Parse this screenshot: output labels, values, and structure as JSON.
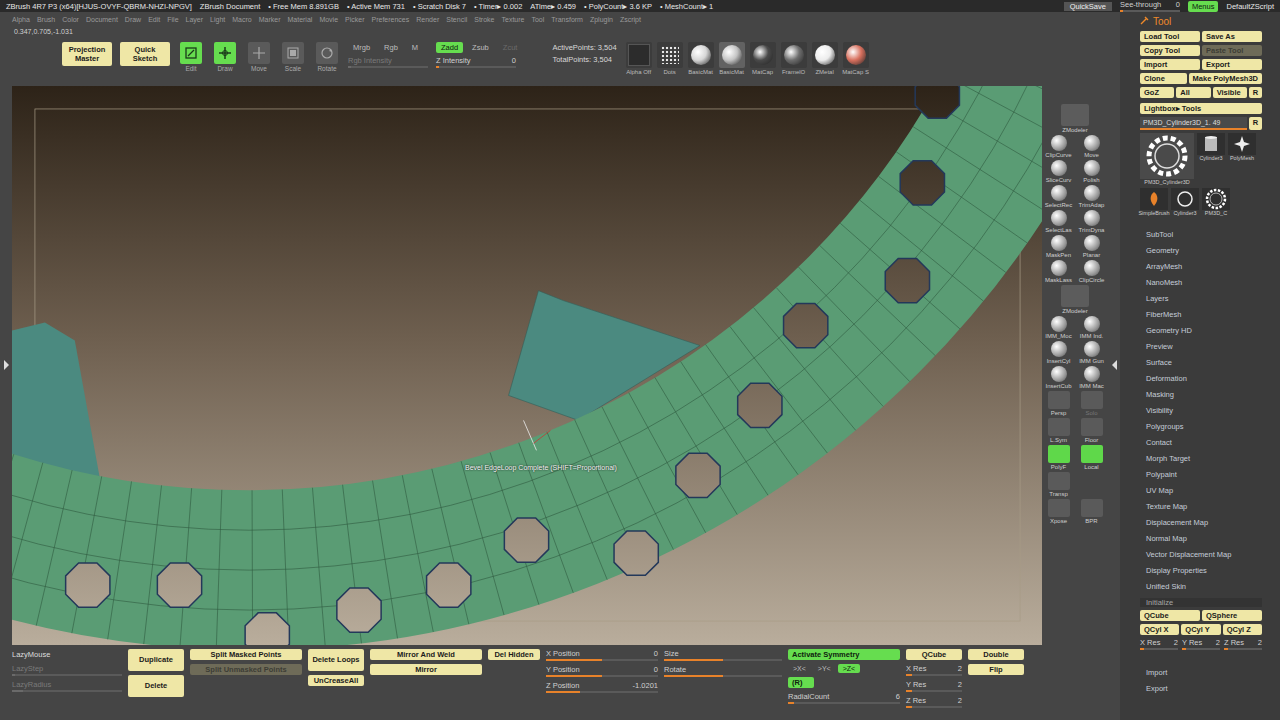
{
  "title_bar": {
    "app": "ZBrush 4R7 P3 (x64)[HJUS-OVYF-QBRM-NHZI-NPGV]",
    "document": "ZBrush Document",
    "stats": [
      "• Free Mem 8.891GB",
      "• Active Mem 731",
      "• Scratch Disk 7",
      "• Timer▸ 0.002",
      "ATime▸ 0.459",
      "• PolyCount▸ 3.6 KP",
      "• MeshCount▸ 1"
    ],
    "quicksave": "QuickSave",
    "see_through": {
      "label": "See-through",
      "reading": "0",
      "level": 0
    },
    "menus": {
      "label": "Menus",
      "selected": true
    },
    "script": "DefaultZScript"
  },
  "menu": [
    "Alpha",
    "Brush",
    "Color",
    "Document",
    "Draw",
    "Edit",
    "File",
    "Layer",
    "Light",
    "Macro",
    "Marker",
    "Material",
    "Movie",
    "Picker",
    "Preferences",
    "Render",
    "Stencil",
    "Stroke",
    "Texture",
    "Tool",
    "Transform",
    "Zplugin",
    "Zscript"
  ],
  "coords": "0.347,0.705,-1.031",
  "toolbar": {
    "big_buttons": [
      "Projection Master",
      "Quick Sketch"
    ],
    "modes": [
      {
        "label": "Edit",
        "selected": true
      },
      {
        "label": "Draw",
        "selected": true
      },
      {
        "label": "Move",
        "selected": false
      },
      {
        "label": "Scale",
        "selected": false
      },
      {
        "label": "Rotate",
        "selected": false
      }
    ],
    "channels": [
      {
        "label": "Mrgb",
        "selected": false
      },
      {
        "label": "Rgb",
        "selected": false
      },
      {
        "label": "M",
        "selected": false
      }
    ],
    "rgb_intensity": {
      "label": "Rgb Intensity",
      "level": 0,
      "disabled": true
    },
    "z_modes": [
      {
        "label": "Zadd",
        "selected": true,
        "disabled": false
      },
      {
        "label": "Zsub",
        "selected": false,
        "disabled": false
      },
      {
        "label": "Zcut",
        "selected": false,
        "disabled": true
      }
    ],
    "z_intensity": {
      "label": "Z Intensity",
      "reading": "0",
      "level": 0
    },
    "points": [
      "ActivePoints: 3,504",
      "TotalPoints: 3,504"
    ],
    "materials": [
      {
        "label": "Alpha Off",
        "kind": "alpha",
        "color": "#2c2c2c",
        "selected": false
      },
      {
        "label": "Dots",
        "kind": "stroke",
        "color": "#e8e8e8",
        "selected": false
      },
      {
        "label": "BasicMat",
        "kind": "sphere",
        "color": "#d6d6d6",
        "selected": false
      },
      {
        "label": "BasicMat",
        "kind": "sphere",
        "color": "#c4c4c4",
        "selected": true
      },
      {
        "label": "MatCap",
        "kind": "sphere",
        "color": "#4a4a4a",
        "selected": false
      },
      {
        "label": "FramelO",
        "kind": "sphere",
        "color": "#6e6e6e",
        "selected": false
      },
      {
        "label": "ZMetal",
        "kind": "sphere",
        "color": "#ececec",
        "selected": false
      },
      {
        "label": "MatCap S",
        "kind": "sphere",
        "color": "#d8705e",
        "selected": false
      }
    ]
  },
  "viewport": {
    "tooltip": "Bevel EdgeLoop Complete (SHIFT=Proportional)"
  },
  "shelf": [
    {
      "label": "ZModeler",
      "kind": "wide",
      "selected": false,
      "disabled": false
    },
    {
      "label": "ClipCurve",
      "kind": "brush",
      "selected": false,
      "disabled": false
    },
    {
      "label": "Move",
      "kind": "brush",
      "selected": false,
      "disabled": false
    },
    {
      "label": "SliceCurv",
      "kind": "brush",
      "selected": false,
      "disabled": false
    },
    {
      "label": "Polish",
      "kind": "brush",
      "selected": false,
      "disabled": false
    },
    {
      "label": "SelectRec",
      "kind": "brush",
      "selected": false,
      "disabled": false
    },
    {
      "label": "TrimAdap",
      "kind": "brush",
      "selected": false,
      "disabled": false
    },
    {
      "label": "SelectLas",
      "kind": "brush",
      "selected": false,
      "disabled": false
    },
    {
      "label": "TrimDyna",
      "kind": "brush",
      "selected": false,
      "disabled": false
    },
    {
      "label": "MaskPen",
      "kind": "brush",
      "selected": false,
      "disabled": false
    },
    {
      "label": "Planar",
      "kind": "brush",
      "selected": false,
      "disabled": false
    },
    {
      "label": "MaskLass",
      "kind": "brush",
      "selected": false,
      "disabled": false
    },
    {
      "label": "ClipCircle",
      "kind": "brush",
      "selected": false,
      "disabled": false
    },
    {
      "label": "ZModeler",
      "kind": "wide",
      "selected": false,
      "disabled": false
    },
    {
      "label": "IMM_Moc",
      "kind": "brush",
      "selected": false,
      "disabled": false
    },
    {
      "label": "IMM Ind.",
      "kind": "brush",
      "selected": false,
      "disabled": false
    },
    {
      "label": "InsertCyl",
      "kind": "brush",
      "selected": false,
      "disabled": false
    },
    {
      "label": "IMM Gun",
      "kind": "brush",
      "selected": false,
      "disabled": false
    },
    {
      "label": "InsertCub",
      "kind": "brush",
      "selected": false,
      "disabled": false
    },
    {
      "label": "IMM Mac",
      "kind": "brush",
      "selected": false,
      "disabled": false
    },
    {
      "label": "Persp",
      "kind": "toggle",
      "selected": false,
      "disabled": false
    },
    {
      "label": "Solo",
      "kind": "toggle",
      "selected": false,
      "disabled": true
    },
    {
      "label": "L.Sym",
      "kind": "toggle",
      "selected": false,
      "disabled": false
    },
    {
      "label": "Floor",
      "kind": "toggle",
      "selected": false,
      "disabled": false
    },
    {
      "label": "PolyF",
      "kind": "toggle",
      "selected": true,
      "disabled": false
    },
    {
      "label": "Local",
      "kind": "toggle",
      "selected": true,
      "disabled": false
    },
    {
      "label": "Transp",
      "kind": "toggle",
      "selected": false,
      "disabled": false
    },
    {
      "label": "",
      "kind": "spacer",
      "selected": false,
      "disabled": false
    },
    {
      "label": "Xpose",
      "kind": "toggle",
      "selected": false,
      "disabled": false
    },
    {
      "label": "BPR",
      "kind": "toggle",
      "selected": false,
      "disabled": false
    }
  ],
  "tool_panel": {
    "title": "Tool",
    "buttons": [
      [
        {
          "label": "Load Tool",
          "disabled": false
        },
        {
          "label": "Save As",
          "disabled": false
        }
      ],
      [
        {
          "label": "Copy Tool",
          "disabled": false
        },
        {
          "label": "Paste Tool",
          "disabled": true
        }
      ],
      [
        {
          "label": "Import",
          "disabled": false
        },
        {
          "label": "Export",
          "disabled": false
        }
      ],
      [
        {
          "label": "Clone",
          "disabled": false
        },
        {
          "label": "Make PolyMesh3D",
          "disabled": false
        }
      ],
      [
        {
          "label": "GoZ",
          "disabled": false
        },
        {
          "label": "All",
          "disabled": false
        },
        {
          "label": "Visible",
          "disabled": false
        },
        {
          "label": "R",
          "disabled": false
        }
      ]
    ],
    "lightbox": "Lightbox▸ Tools",
    "current": {
      "label": "PM3D_Cylinder3D_1. 49",
      "reading": "R"
    },
    "thumbnails": [
      {
        "label": "PM3D_Cylinder3D",
        "kind": "gear",
        "selected": true
      },
      {
        "label": "Cylinder3",
        "kind": "cylinder",
        "selected": false
      },
      {
        "label": "PolyMesh",
        "kind": "star",
        "selected": false
      },
      {
        "label": "SimpleBrush",
        "kind": "brush",
        "selected": false
      },
      {
        "label": "Cylinder3",
        "kind": "ring",
        "selected": false
      },
      {
        "label": "PM3D_C",
        "kind": "gear",
        "selected": false
      }
    ],
    "sections": [
      "SubTool",
      "Geometry",
      "ArrayMesh",
      "NanoMesh",
      "Layers",
      "FiberMesh",
      "Geometry HD",
      "Preview",
      "Surface",
      "Deformation",
      "Masking",
      "Visibility",
      "Polygroups",
      "Contact",
      "Morph Target",
      "Polypaint",
      "UV Map",
      "Texture Map",
      "Displacement Map",
      "Normal Map",
      "Vector Displacement Map",
      "Display Properties",
      "Unified Skin"
    ],
    "initialize": {
      "title": "Initialize",
      "buttons": [
        [
          "QCube",
          "QSphere"
        ],
        [
          "QCyl X",
          "QCyl Y",
          "QCyl Z"
        ]
      ],
      "sliders": [
        {
          "label": "X Res",
          "reading": "2",
          "level": 0.1
        },
        {
          "label": "Y Res",
          "reading": "2",
          "level": 0.1
        },
        {
          "label": "Z Res",
          "reading": "2",
          "level": 0.1
        }
      ]
    },
    "footer": [
      "Import",
      "Export"
    ]
  },
  "bottom": [
    {
      "width": 110,
      "items": [
        {
          "kind": "text",
          "label": "LazyMouse"
        },
        {
          "kind": "slider",
          "label": "LazyStep",
          "level": 0,
          "disabled": true
        },
        {
          "kind": "slider",
          "label": "LazyRadius",
          "level": 0.1,
          "disabled": true
        }
      ]
    },
    {
      "width": 56,
      "items": [
        {
          "kind": "bigbutton",
          "label": "Duplicate",
          "disabled": false
        },
        {
          "kind": "bigbutton",
          "label": "Delete",
          "disabled": false
        }
      ]
    },
    {
      "width": 112,
      "items": [
        {
          "kind": "button",
          "label": "Split Masked Points",
          "disabled": false
        },
        {
          "kind": "button",
          "label": "Split Unmasked Points",
          "disabled": true
        }
      ]
    },
    {
      "width": 56,
      "items": [
        {
          "kind": "bigbutton",
          "label": "Delete Loops",
          "disabled": false
        },
        {
          "kind": "button",
          "label": "UnCreaseAll",
          "disabled": false
        }
      ]
    },
    {
      "width": 112,
      "items": [
        {
          "kind": "button",
          "label": "Mirror And Weld",
          "disabled": false
        },
        {
          "kind": "button",
          "label": "Mirror",
          "disabled": false
        }
      ]
    },
    {
      "width": 52,
      "items": [
        {
          "kind": "button",
          "label": "Del Hidden",
          "disabled": false
        }
      ]
    },
    {
      "width": 112,
      "items": [
        {
          "kind": "slider",
          "label": "X Position",
          "reading": "0",
          "level": 0.5,
          "disabled": false
        },
        {
          "kind": "slider",
          "label": "Y Position",
          "reading": "0",
          "level": 0.5,
          "disabled": false
        },
        {
          "kind": "slider",
          "label": "Z Position",
          "reading": "-1.0201",
          "level": 0.3,
          "disabled": false
        }
      ]
    },
    {
      "width": 118,
      "items": [
        {
          "kind": "slider",
          "label": "Size",
          "level": 0.5,
          "disabled": false
        },
        {
          "kind": "slider",
          "label": "Rotate",
          "level": 0.5,
          "disabled": false
        }
      ]
    },
    {
      "width": 112,
      "items": [
        {
          "kind": "toggle",
          "label": "Activate Symmetry",
          "selected": true
        },
        {
          "kind": "toggles",
          "items": [
            {
              "label": ">X<",
              "selected": false
            },
            {
              "label": ">Y<",
              "selected": false
            },
            {
              "label": ">Z<",
              "selected": true
            }
          ]
        },
        {
          "kind": "toggle",
          "label": "(R)",
          "selected": true
        },
        {
          "kind": "slider",
          "label": "RadialCount",
          "reading": "6",
          "level": 0.05,
          "disabled": false
        }
      ]
    },
    {
      "width": 56,
      "items": [
        {
          "kind": "button",
          "label": "QCube",
          "disabled": false
        },
        {
          "kind": "slider",
          "label": "X Res",
          "reading": "2",
          "level": 0.1,
          "disabled": false
        },
        {
          "kind": "slider",
          "label": "Y Res",
          "reading": "2",
          "level": 0.1,
          "disabled": false
        },
        {
          "kind": "slider",
          "label": "Z Res",
          "reading": "2",
          "level": 0.1,
          "disabled": false
        }
      ]
    },
    {
      "width": 56,
      "items": [
        {
          "kind": "button",
          "label": "Double",
          "disabled": false
        },
        {
          "kind": "button",
          "label": "Flip",
          "disabled": false
        }
      ]
    }
  ]
}
